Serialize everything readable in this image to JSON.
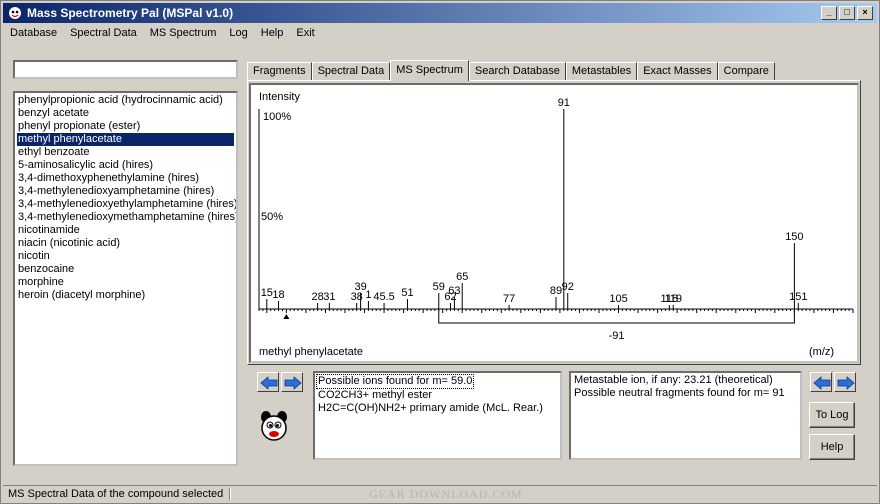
{
  "window": {
    "title": "Mass Spectrometry Pal  (MSPal  v1.0)",
    "controls": {
      "minimize": "_",
      "maximize": "□",
      "close": "×"
    }
  },
  "menu": [
    "Database",
    "Spectral Data",
    "MS Spectrum",
    "Log",
    "Help",
    "Exit"
  ],
  "search": {
    "value": ""
  },
  "compounds": [
    "phenylpropionic acid (hydrocinnamic acid)",
    "benzyl acetate",
    "phenyl propionate (ester)",
    "methyl phenylacetate",
    "ethyl benzoate",
    "5-aminosalicylic acid (hires)",
    "3,4-dimethoxyphenethylamine (hires)",
    "3,4-methylenedioxyamphetamine (hires)",
    "3,4-methylenedioxyethylamphetamine (hires)",
    "3,4-methylenedioxymethamphetamine (hires)",
    "nicotinamide",
    "niacin (nicotinic acid)",
    "nicotin",
    "benzocaine",
    "morphine",
    "heroin (diacetyl morphine)"
  ],
  "selected_compound_index": 3,
  "tabs": [
    "Fragments",
    "Spectral Data",
    "MS Spectrum",
    "Search Database",
    "Metastables",
    "Exact Masses",
    "Compare"
  ],
  "active_tab": "MS Spectrum",
  "chart_data": {
    "type": "bar",
    "title": "",
    "ylabel": "Intensity",
    "xlabel": "(m/z)",
    "compound_label": "methyl phenylacetate",
    "y_ticks": [
      "100%",
      "50%"
    ],
    "ylim": [
      0,
      100
    ],
    "xlim": [
      13,
      165
    ],
    "peaks": [
      {
        "mz": 15,
        "intensity": 5,
        "label": "15"
      },
      {
        "mz": 18,
        "intensity": 4,
        "label": "18"
      },
      {
        "mz": 28,
        "intensity": 3,
        "label": "28"
      },
      {
        "mz": 31,
        "intensity": 3,
        "label": "31"
      },
      {
        "mz": 38,
        "intensity": 3,
        "label": "38"
      },
      {
        "mz": 39,
        "intensity": 8,
        "label": "39"
      },
      {
        "mz": 41,
        "intensity": 4,
        "label": "1"
      },
      {
        "mz": 45,
        "intensity": 3,
        "label": "45.5"
      },
      {
        "mz": 51,
        "intensity": 5,
        "label": "51"
      },
      {
        "mz": 59,
        "intensity": 8,
        "label": "59"
      },
      {
        "mz": 62,
        "intensity": 3,
        "label": "62"
      },
      {
        "mz": 63,
        "intensity": 6,
        "label": "63"
      },
      {
        "mz": 65,
        "intensity": 13,
        "label": "65"
      },
      {
        "mz": 77,
        "intensity": 2,
        "label": "77"
      },
      {
        "mz": 89,
        "intensity": 6,
        "label": "89"
      },
      {
        "mz": 91,
        "intensity": 100,
        "label": "91"
      },
      {
        "mz": 92,
        "intensity": 8,
        "label": "92"
      },
      {
        "mz": 105,
        "intensity": 2,
        "label": "105"
      },
      {
        "mz": 118,
        "intensity": 2,
        "label": "118"
      },
      {
        "mz": 119,
        "intensity": 2,
        "label": "119"
      },
      {
        "mz": 150,
        "intensity": 33,
        "label": "150"
      },
      {
        "mz": 151,
        "intensity": 3,
        "label": "151"
      }
    ],
    "neutral_loss": {
      "from_mz": 59,
      "to_mz": 150,
      "label": "-91"
    },
    "cursor_mz": 20
  },
  "ions_panel": {
    "lines": [
      "Possible ions found for m= 59.0",
      "CO2CH3+   methyl ester",
      "H2C=C(OH)NH2+ primary amide (McL. Rear.)"
    ]
  },
  "metastable_panel": {
    "lines": [
      "Metastable ion, if any:  23.21 (theoretical)",
      "Possible neutral fragments found for m= 91"
    ]
  },
  "buttons": {
    "to_log": "To Log",
    "help": "Help"
  },
  "status": "MS Spectral Data of the compound selected",
  "watermark": "GEAR DOWNLOAD.COM",
  "colors": {
    "title_start": "#0a246a",
    "title_end": "#a6caf0",
    "selection": "#0a246a",
    "arrow": "#2a6fd8"
  }
}
